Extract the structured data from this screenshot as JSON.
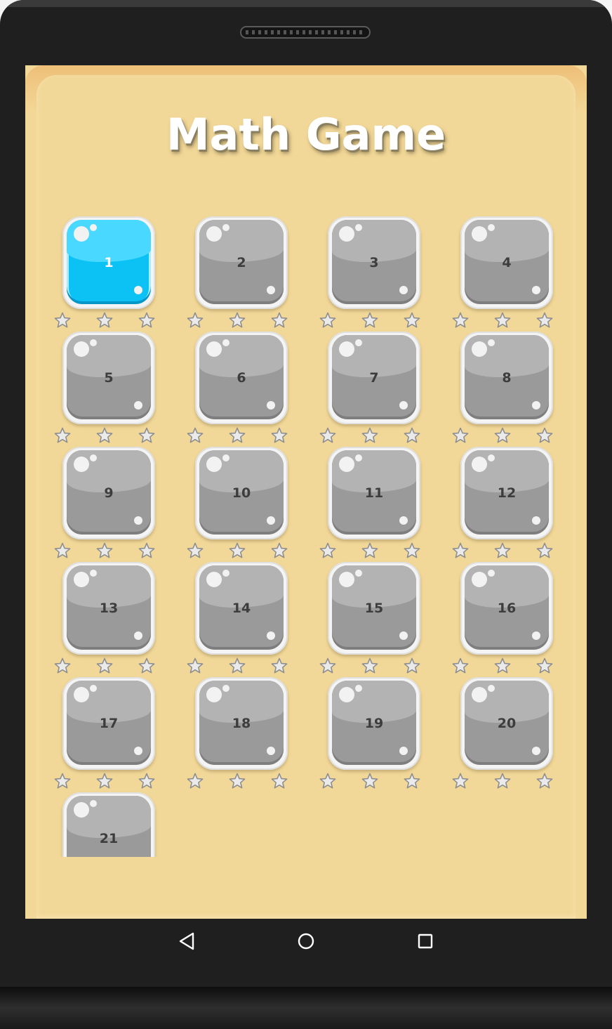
{
  "app": {
    "title": "Math Game"
  },
  "levels": [
    {
      "label": "1",
      "state": "unlocked",
      "stars": 0
    },
    {
      "label": "2",
      "state": "locked",
      "stars": 0
    },
    {
      "label": "3",
      "state": "locked",
      "stars": 0
    },
    {
      "label": "4",
      "state": "locked",
      "stars": 0
    },
    {
      "label": "5",
      "state": "locked",
      "stars": 0
    },
    {
      "label": "6",
      "state": "locked",
      "stars": 0
    },
    {
      "label": "7",
      "state": "locked",
      "stars": 0
    },
    {
      "label": "8",
      "state": "locked",
      "stars": 0
    },
    {
      "label": "9",
      "state": "locked",
      "stars": 0
    },
    {
      "label": "10",
      "state": "locked",
      "stars": 0
    },
    {
      "label": "11",
      "state": "locked",
      "stars": 0
    },
    {
      "label": "12",
      "state": "locked",
      "stars": 0
    },
    {
      "label": "13",
      "state": "locked",
      "stars": 0
    },
    {
      "label": "14",
      "state": "locked",
      "stars": 0
    },
    {
      "label": "15",
      "state": "locked",
      "stars": 0
    },
    {
      "label": "16",
      "state": "locked",
      "stars": 0
    },
    {
      "label": "17",
      "state": "locked",
      "stars": 0
    },
    {
      "label": "18",
      "state": "locked",
      "stars": 0
    },
    {
      "label": "19",
      "state": "locked",
      "stars": 0
    },
    {
      "label": "20",
      "state": "locked",
      "stars": 0
    },
    {
      "label": "21",
      "state": "locked",
      "stars": 0
    }
  ],
  "stars_per_level": 3,
  "colors": {
    "background": "#f2d898",
    "tile_active": "#0cc2f4",
    "tile_locked": "#9a9a9a",
    "title_text": "#ffffff"
  },
  "navbar": {
    "back_icon": "triangle-back-icon",
    "home_icon": "circle-home-icon",
    "recents_icon": "square-recents-icon"
  }
}
